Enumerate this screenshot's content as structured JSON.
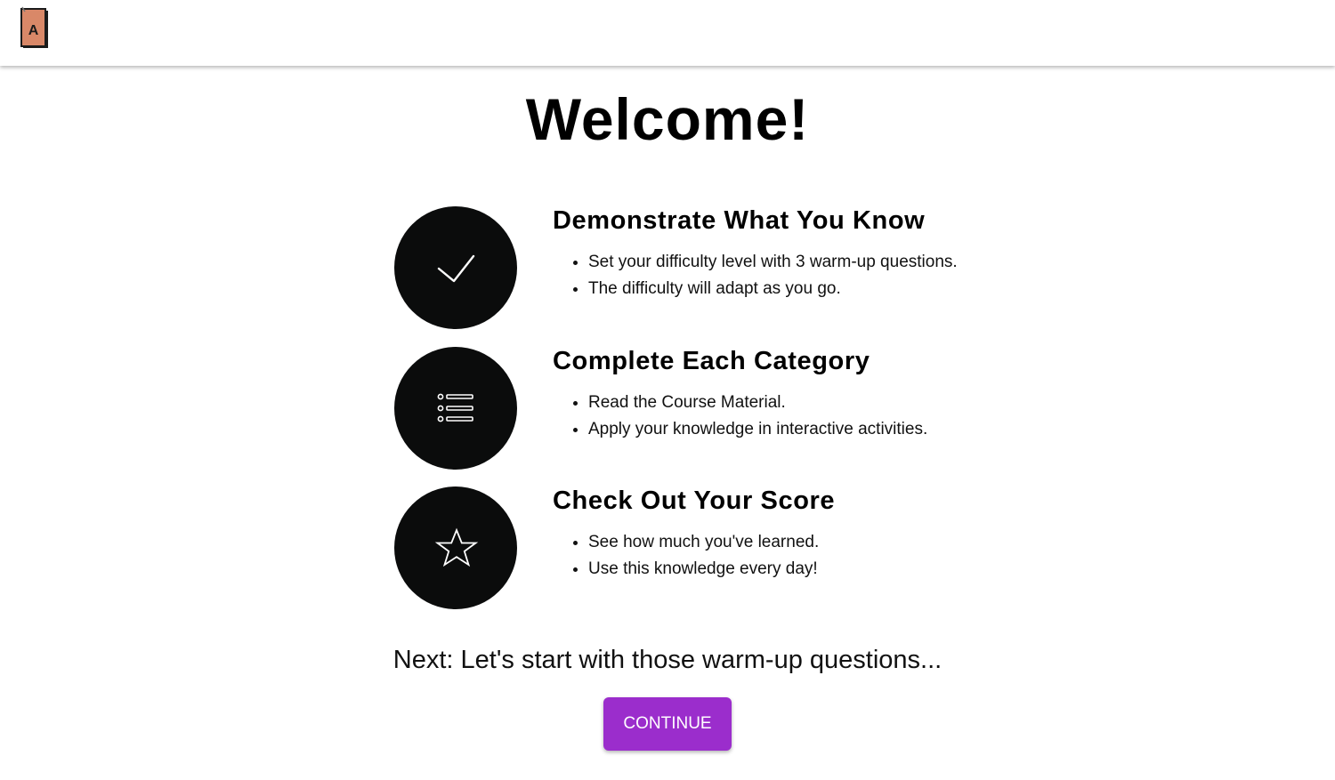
{
  "header": {
    "logo_letter": "A",
    "logo_icon": "book-logo-icon"
  },
  "main": {
    "title": "Welcome!",
    "steps": [
      {
        "icon": "checkmark-icon",
        "heading": "Demonstrate What You Know",
        "bullets": [
          "Set your difficulty level with 3 warm-up questions.",
          "The difficulty will adapt as you go."
        ]
      },
      {
        "icon": "list-icon",
        "heading": "Complete Each Category",
        "bullets": [
          "Read the Course Material.",
          "Apply your knowledge in interactive activities."
        ]
      },
      {
        "icon": "star-icon",
        "heading": "Check Out Your Score",
        "bullets": [
          "See how much you've learned.",
          "Use this knowledge every day!"
        ]
      }
    ],
    "next_text": "Next: Let's start with those warm-up questions...",
    "continue_label": "CONTINUE"
  },
  "colors": {
    "accent": "#9b2dcc",
    "circle": "#0b0c0c",
    "logo_fill": "#d98868"
  }
}
